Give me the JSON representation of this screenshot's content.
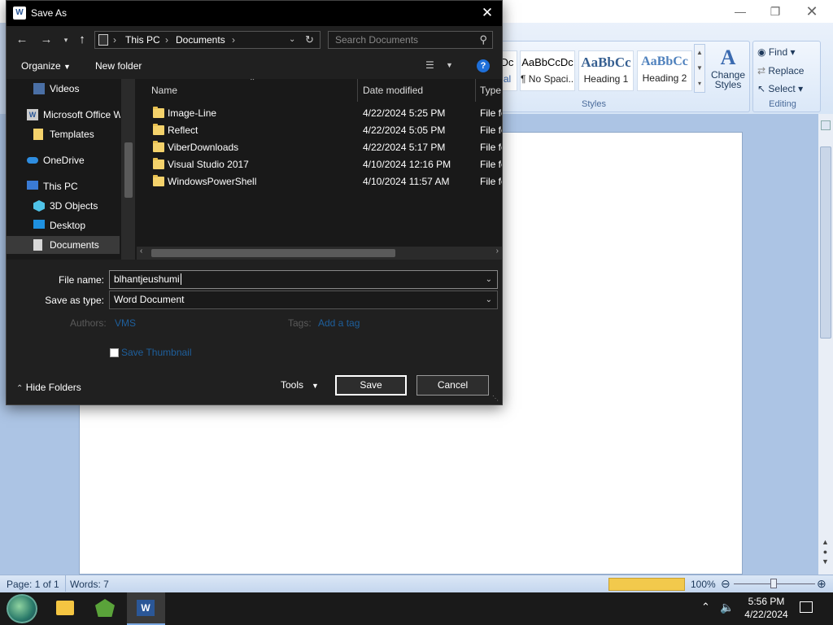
{
  "dialog": {
    "title": "Save As",
    "address": {
      "this_pc": "This PC",
      "documents": "Documents"
    },
    "search_placeholder": "Search Documents",
    "organize": "Organize",
    "new_folder": "New folder",
    "nav_items": [
      {
        "label": "Videos"
      },
      {
        "label": "Microsoft Office W"
      },
      {
        "label": "Templates"
      },
      {
        "label": "OneDrive"
      },
      {
        "label": "This PC"
      },
      {
        "label": "3D Objects"
      },
      {
        "label": "Desktop"
      },
      {
        "label": "Documents"
      }
    ],
    "columns": {
      "name": "Name",
      "date": "Date modified",
      "type": "Type"
    },
    "files": [
      {
        "name": "Image-Line",
        "date": "4/22/2024 5:25 PM",
        "type": "File fo"
      },
      {
        "name": "Reflect",
        "date": "4/22/2024 5:05 PM",
        "type": "File fo"
      },
      {
        "name": "ViberDownloads",
        "date": "4/22/2024 5:17 PM",
        "type": "File fo"
      },
      {
        "name": "Visual Studio 2017",
        "date": "4/10/2024 12:16 PM",
        "type": "File fo"
      },
      {
        "name": "WindowsPowerShell",
        "date": "4/10/2024 11:57 AM",
        "type": "File fo"
      }
    ],
    "file_name_label": "File name:",
    "file_name_value": "blhantjeushumi",
    "save_type_label": "Save as type:",
    "save_type_value": "Word Document",
    "authors_label": "Authors:",
    "authors_value": "VMS",
    "tags_label": "Tags:",
    "tags_value": "Add a tag",
    "thumbnail_label": "Save Thumbnail",
    "hide_folders": "Hide Folders",
    "tools": "Tools",
    "save": "Save",
    "cancel": "Cancel"
  },
  "ribbon": {
    "styles": [
      {
        "sample": "Dc",
        "name": "al"
      },
      {
        "sample": "AaBbCcDc",
        "name": "¶ No Spaci..."
      },
      {
        "sample": "AaBbCc",
        "name": "Heading 1"
      },
      {
        "sample": "AaBbCc",
        "name": "Heading 2"
      }
    ],
    "change_styles": "Change Styles",
    "styles_group": "Styles",
    "find": "Find",
    "replace": "Replace",
    "select": "Select",
    "editing_group": "Editing"
  },
  "status": {
    "page": "Page: 1 of 1",
    "words": "Words: 7",
    "zoom": "100%"
  },
  "taskbar": {
    "time": "5:56 PM",
    "date": "4/22/2024"
  },
  "colors": {
    "folder": "#f4d26b",
    "dialog_bg": "#202020",
    "ribbon_accent": "#4a6b9a"
  }
}
